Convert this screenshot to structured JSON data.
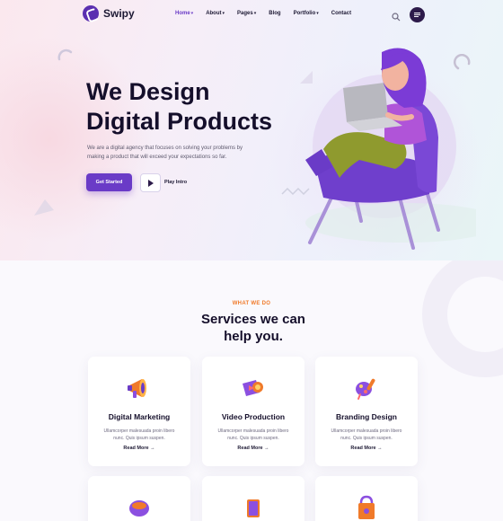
{
  "brand": {
    "name": "Swipy",
    "color": "#5b2fb0"
  },
  "nav": {
    "items": [
      {
        "label": "Home",
        "caret": "▾",
        "active": true
      },
      {
        "label": "About",
        "caret": "▾"
      },
      {
        "label": "Pages",
        "caret": "▾"
      },
      {
        "label": "Blog",
        "caret": ""
      },
      {
        "label": "Portfolio",
        "caret": "▾"
      },
      {
        "label": "Contact",
        "caret": ""
      }
    ],
    "search_icon": "search-icon",
    "menu_icon": "hamburger-icon"
  },
  "hero": {
    "title_line1": "We Design",
    "title_line2": "Digital Products",
    "description": "We are a digital agency that focuses on solving your problems by making a product that will exceed your expectations so far.",
    "primary_button": "Get Started",
    "play_label": "Play Intro",
    "accent": "#6a3bc7"
  },
  "services": {
    "eyebrow": "WHAT WE DO",
    "title_line1": "Services we can",
    "title_line2": "help you.",
    "cards": [
      {
        "title": "Digital Marketing",
        "desc": "Ullamcorper malesuada proin libero nunc. Quis ipsum suspen.",
        "link": "Read More",
        "icon": "megaphone-icon"
      },
      {
        "title": "Video Production",
        "desc": "Ullamcorper malesuada proin libero nunc. Quis ipsum suspen.",
        "link": "Read More",
        "icon": "video-camera-icon"
      },
      {
        "title": "Branding Design",
        "desc": "Ullamcorper malesuada proin libero nunc. Quis ipsum suspen.",
        "link": "Read More",
        "icon": "branding-brush-icon"
      }
    ],
    "next_row_icons": [
      "paint-bucket-icon",
      "monitor-icon",
      "shopping-bag-icon"
    ],
    "arrow": "→"
  }
}
